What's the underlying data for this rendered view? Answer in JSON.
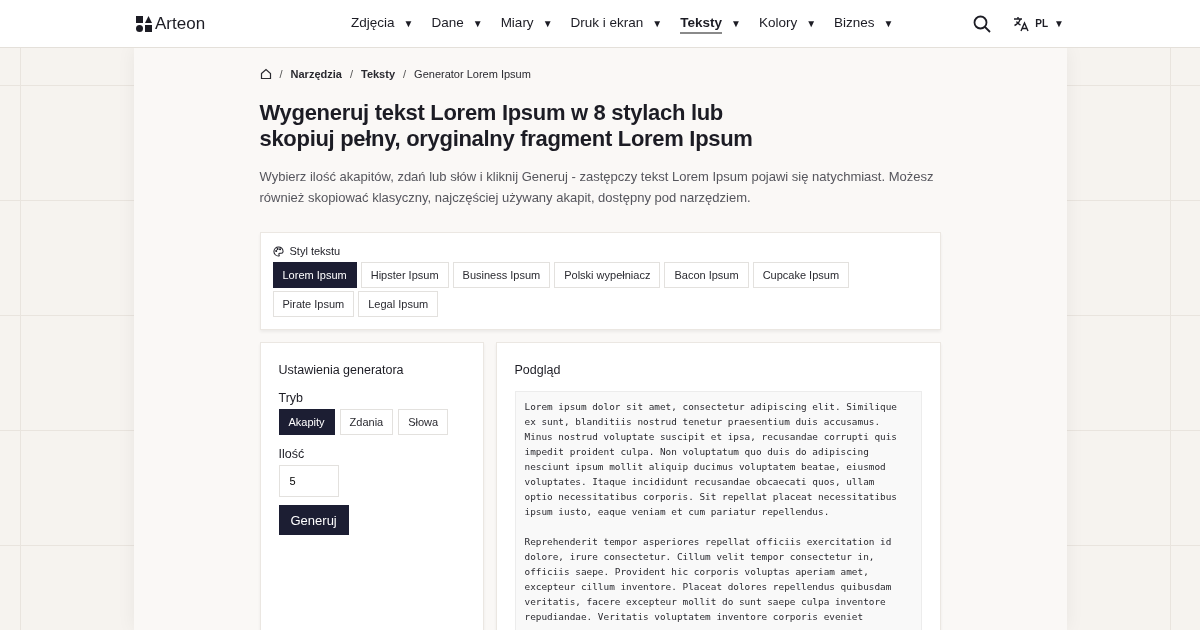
{
  "header": {
    "logo": "Arteon",
    "nav": [
      {
        "label": "Zdjęcia",
        "caret": "▼",
        "selected": false
      },
      {
        "label": "Dane",
        "caret": "▼",
        "selected": false
      },
      {
        "label": "Miary",
        "caret": "▼",
        "selected": false
      },
      {
        "label": "Druk i ekran",
        "caret": "▼",
        "selected": false
      },
      {
        "label": "Teksty",
        "caret": "▼",
        "selected": true
      },
      {
        "label": "Kolory",
        "caret": "▼",
        "selected": false
      },
      {
        "label": "Biznes",
        "caret": "▼",
        "selected": false
      }
    ],
    "language": {
      "code": "PL",
      "caret": "▼"
    }
  },
  "breadcrumb": [
    {
      "label": "Narzędzia",
      "kind": "link"
    },
    {
      "label": "Teksty",
      "kind": "link"
    },
    {
      "label": "Generator Lorem Ipsum",
      "kind": "current"
    }
  ],
  "breadcrumb_separator": "/",
  "title": "Wygeneruj tekst Lorem Ipsum w 8 stylach lub skopiuj pełny, oryginalny fragment Lorem Ipsum",
  "intro": "Wybierz ilość akapitów, zdań lub słów i kliknij Generuj - zastępczy tekst Lorem Ipsum pojawi się natychmiast. Możesz również skopiować klasyczny, najczęściej używany akapit, dostępny pod narzędziem.",
  "style_panel": {
    "label": "Styl tekstu",
    "options": [
      {
        "label": "Lorem Ipsum",
        "selected": true
      },
      {
        "label": "Hipster Ipsum",
        "selected": false
      },
      {
        "label": "Business Ipsum",
        "selected": false
      },
      {
        "label": "Polski wypełniacz",
        "selected": false
      },
      {
        "label": "Bacon Ipsum",
        "selected": false
      },
      {
        "label": "Cupcake Ipsum",
        "selected": false
      },
      {
        "label": "Pirate Ipsum",
        "selected": false
      },
      {
        "label": "Legal Ipsum",
        "selected": false
      }
    ]
  },
  "settings": {
    "title": "Ustawienia generatora",
    "mode_label": "Tryb",
    "modes": [
      {
        "label": "Akapity",
        "selected": true
      },
      {
        "label": "Zdania",
        "selected": false
      },
      {
        "label": "Słowa",
        "selected": false
      }
    ],
    "count_label": "Ilość",
    "count_value": "5",
    "button": "Generuj"
  },
  "preview": {
    "title": "Podgląd",
    "paragraphs": [
      "Lorem ipsum dolor sit amet, consectetur adipiscing elit. Similique ex sunt, blanditiis nostrud tenetur praesentium duis accusamus. Minus nostrud voluptate suscipit et ipsa, recusandae corrupti quis impedit proident culpa. Non voluptatum quo duis do adipiscing nesciunt ipsum mollit aliquip ducimus voluptatem beatae, eiusmod voluptates. Itaque incididunt recusandae obcaecati quos, ullam optio necessitatibus corporis. Sit repellat placeat necessitatibus ipsum iusto, eaque veniam et cum pariatur repellendus.",
      "Reprehenderit tempor asperiores repellat officiis exercitation id dolore, irure consectetur. Cillum velit tempor consectetur in, officiis saepe. Provident hic corporis voluptas aperiam amet, excepteur cillum inventore. Placeat dolores repellendus quibusdam veritatis, facere excepteur mollit do sunt saepe culpa inventore repudiandae. Veritatis voluptatem inventore corporis eveniet"
    ]
  }
}
